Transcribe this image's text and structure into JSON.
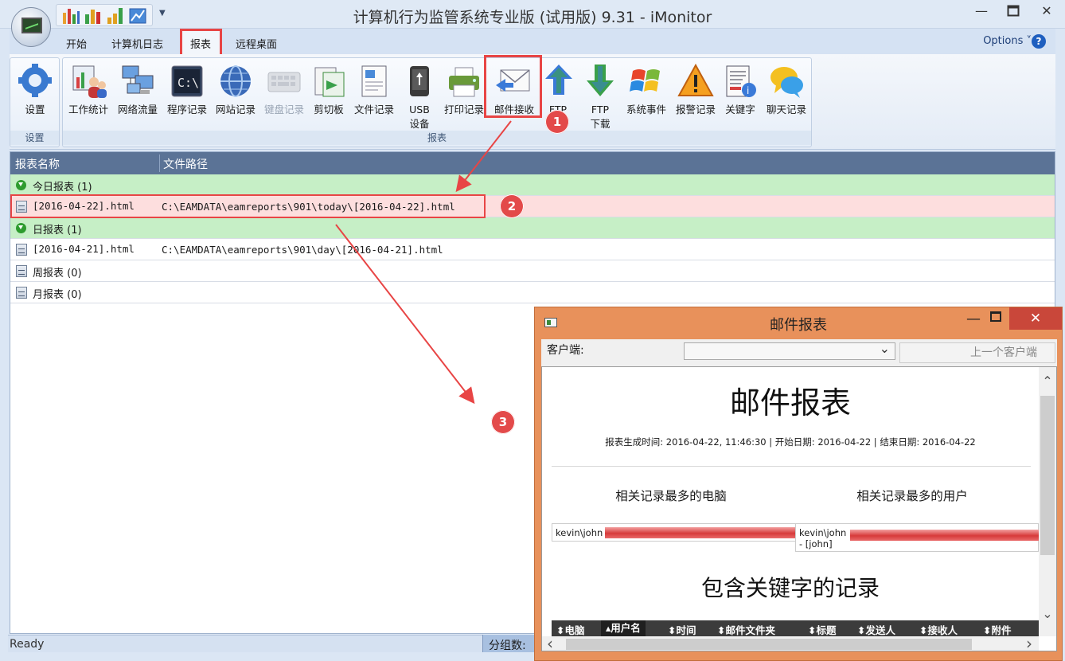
{
  "window": {
    "title": "计算机行为监管系统专业版 (试用版) 9.31 - iMonitor",
    "minimize": "—",
    "close": "✕"
  },
  "ribbon_tabs": [
    "开始",
    "计算机日志",
    "报表",
    "远程桌面"
  ],
  "options_label": "Options",
  "ribbon": {
    "settings_group": {
      "label": "设置",
      "buttons": [
        {
          "label": "设置",
          "icon": "gear-icon"
        }
      ]
    },
    "report_group": {
      "label": "报表",
      "buttons": [
        {
          "label": "工作统计",
          "icon": "people-chart-icon"
        },
        {
          "label": "网络流量",
          "icon": "network-icon"
        },
        {
          "label": "程序记录",
          "icon": "cmd-icon"
        },
        {
          "label": "网站记录",
          "icon": "globe-icon"
        },
        {
          "label": "键盘记录",
          "icon": "keyboard-icon",
          "disabled": true
        },
        {
          "label": "剪切板",
          "icon": "clipboard-icon"
        },
        {
          "label": "文件记录",
          "icon": "file-icon"
        },
        {
          "label": "USB",
          "label2": "设备",
          "icon": "usb-icon"
        },
        {
          "label": "打印记录",
          "icon": "printer-icon"
        },
        {
          "label": "邮件接收",
          "icon": "mail-receive-icon"
        },
        {
          "label": "FTP",
          "label2": "上传",
          "icon": "ftp-upload-icon"
        },
        {
          "label": "FTP",
          "label2": "下载",
          "icon": "ftp-download-icon"
        },
        {
          "label": "系统事件",
          "icon": "windows-icon"
        },
        {
          "label": "报警记录",
          "icon": "warning-icon"
        },
        {
          "label": "关键字",
          "icon": "keyword-icon"
        },
        {
          "label": "聊天记录",
          "icon": "chat-icon"
        }
      ]
    }
  },
  "list": {
    "columns": [
      "报表名称",
      "文件路径"
    ],
    "rows": [
      {
        "kind": "group",
        "name": "今日报表 (1)"
      },
      {
        "kind": "file",
        "name": "[2016-04-22].html",
        "path": "C:\\EAMDATA\\eamreports\\901\\today\\[2016-04-22].html",
        "selected": true
      },
      {
        "kind": "group",
        "name": "日报表 (1)"
      },
      {
        "kind": "file",
        "name": "[2016-04-21].html",
        "path": "C:\\EAMDATA\\eamreports\\901\\day\\[2016-04-21].html"
      },
      {
        "kind": "file",
        "name": "周报表 (0)",
        "path": ""
      },
      {
        "kind": "file",
        "name": "月报表 (0)",
        "path": ""
      }
    ]
  },
  "status": {
    "text": "Ready",
    "group_label": "分组数:"
  },
  "annotations": [
    "1",
    "2",
    "3"
  ],
  "mail_window": {
    "title": "邮件报表",
    "client_label": "客户端:",
    "prev_client": "上一个客户端",
    "report": {
      "title": "邮件报表",
      "meta": "报表生成时间: 2016-04-22, 11:46:30 | 开始日期: 2016-04-22 | 结束日期: 2016-04-22",
      "top_computer_heading": "相关记录最多的电脑",
      "top_user_heading": "相关记录最多的用户",
      "top_computer": "kevin\\john",
      "top_user": "kevin\\john - [john]",
      "keyword_heading": "包含关键字的记录",
      "table_columns": [
        "电脑",
        "用户名",
        "时间",
        "邮件文件夹",
        "标题",
        "发送人",
        "接收人",
        "附件"
      ]
    }
  }
}
